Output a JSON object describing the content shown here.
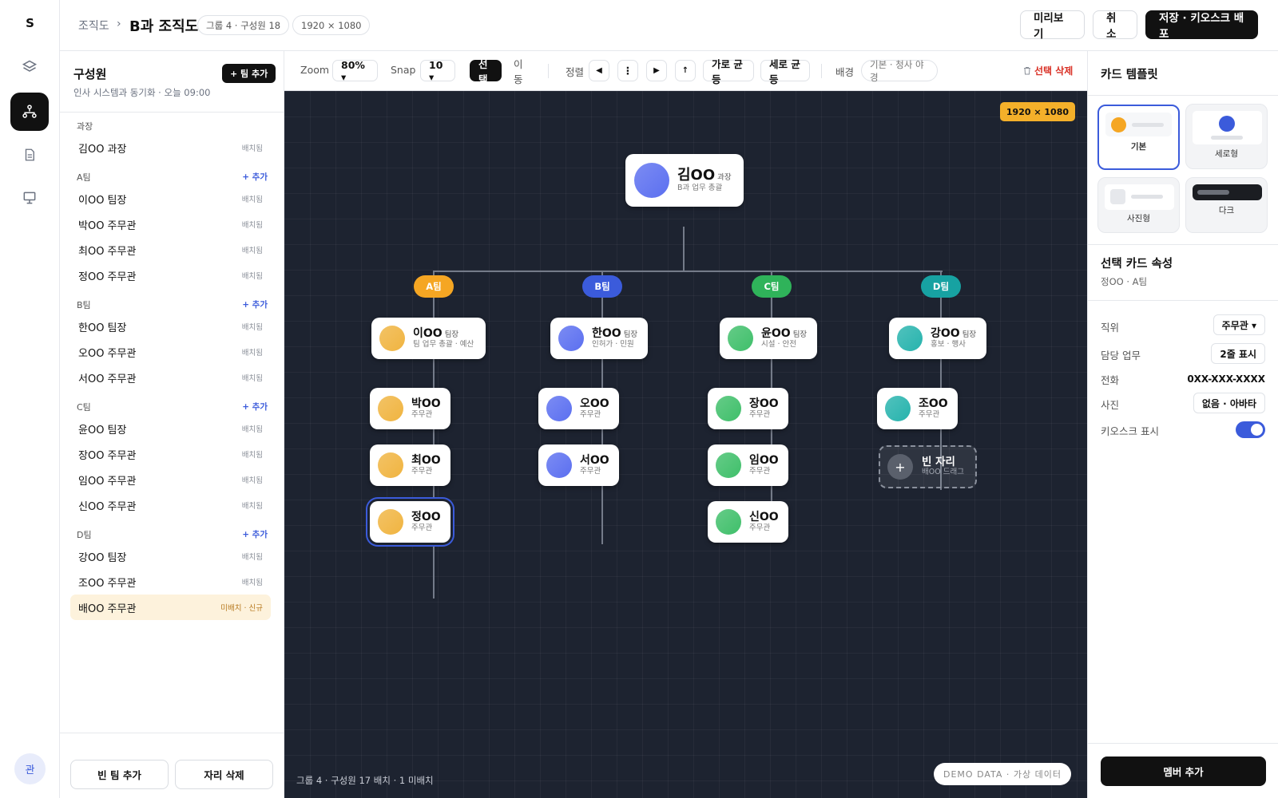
{
  "rail": {
    "logo": "S",
    "avatar": "관"
  },
  "header": {
    "crumb": "조직도",
    "separator": "›",
    "title": "B과 조직도",
    "chip_group": "그룹 4 · 구성원 18",
    "chip_size": "1920 × 1080",
    "preview": "미리보기",
    "cancel": "취소",
    "save": "저장 · 키오스크 배포"
  },
  "left": {
    "title": "구성원",
    "add_team": "+ 팀 추가",
    "sub": "인사 시스템과 동기화 · 오늘 09:00",
    "groups": [
      {
        "name": "과장",
        "add": "",
        "members": [
          {
            "name": "김OO 과장",
            "status": "배치됨"
          }
        ]
      },
      {
        "name": "A팀",
        "add": "+ 추가",
        "members": [
          {
            "name": "이OO 팀장",
            "status": "배치됨"
          },
          {
            "name": "박OO 주무관",
            "status": "배치됨"
          },
          {
            "name": "최OO 주무관",
            "status": "배치됨"
          },
          {
            "name": "정OO 주무관",
            "status": "배치됨"
          }
        ]
      },
      {
        "name": "B팀",
        "add": "+ 추가",
        "members": [
          {
            "name": "한OO 팀장",
            "status": "배치됨"
          },
          {
            "name": "오OO 주무관",
            "status": "배치됨"
          },
          {
            "name": "서OO 주무관",
            "status": "배치됨"
          }
        ]
      },
      {
        "name": "C팀",
        "add": "+ 추가",
        "members": [
          {
            "name": "윤OO 팀장",
            "status": "배치됨"
          },
          {
            "name": "장OO 주무관",
            "status": "배치됨"
          },
          {
            "name": "임OO 주무관",
            "status": "배치됨"
          },
          {
            "name": "신OO 주무관",
            "status": "배치됨"
          }
        ]
      },
      {
        "name": "D팀",
        "add": "+ 추가",
        "members": [
          {
            "name": "강OO 팀장",
            "status": "배치됨"
          },
          {
            "name": "조OO 주무관",
            "status": "배치됨"
          },
          {
            "name": "배OO 주무관",
            "status": "미배치 · 신규"
          }
        ]
      }
    ],
    "empty_team": "빈 팀 추가",
    "delete_slot": "자리 삭제"
  },
  "toolbar": {
    "zoom_label": "Zoom",
    "zoom": "80% ▾",
    "snap_label": "Snap",
    "snap": "10 ▾",
    "select": "선택",
    "move": "이동",
    "align_label": "정렬",
    "align_left": "◀",
    "align_vcenter": "⋮",
    "align_right": "▶",
    "align_top": "↑",
    "dist_h": "가로 균등",
    "dist_v": "세로 균등",
    "bg_label": "배경",
    "bg": "기본 · 청사 야경",
    "delete_sel": "선택 삭제"
  },
  "canvas": {
    "size_badge": "1920 × 1080",
    "root": {
      "name": "김OO",
      "role": "과장",
      "duty": "B과 업무 총괄"
    },
    "teams": [
      {
        "label": "A팀",
        "color": "#f5a623",
        "av": "#f0b440",
        "cards": [
          {
            "name": "이OO",
            "role": "팀장",
            "sub": "팀 업무 총괄 · 예산"
          },
          {
            "name": "박OO",
            "role": "",
            "sub": "주무관"
          },
          {
            "name": "최OO",
            "role": "",
            "sub": "주무관"
          },
          {
            "name": "정OO",
            "role": "",
            "sub": "주무관"
          }
        ]
      },
      {
        "label": "B팀",
        "color": "#3b5bdb",
        "av": "#5b6ff0",
        "cards": [
          {
            "name": "한OO",
            "role": "팀장",
            "sub": "인허가 · 민원"
          },
          {
            "name": "오OO",
            "role": "",
            "sub": "주무관"
          },
          {
            "name": "서OO",
            "role": "",
            "sub": "주무관"
          }
        ]
      },
      {
        "label": "C팀",
        "color": "#2fb35a",
        "av": "#3fbf6a",
        "cards": [
          {
            "name": "윤OO",
            "role": "팀장",
            "sub": "시설 · 안전"
          },
          {
            "name": "장OO",
            "role": "",
            "sub": "주무관"
          },
          {
            "name": "임OO",
            "role": "",
            "sub": "주무관"
          },
          {
            "name": "신OO",
            "role": "",
            "sub": "주무관"
          }
        ]
      },
      {
        "label": "D팀",
        "color": "#17a2a2",
        "av": "#26b3ad",
        "cards": [
          {
            "name": "강OO",
            "role": "팀장",
            "sub": "홍보 · 행사"
          },
          {
            "name": "조OO",
            "role": "",
            "sub": "주무관"
          }
        ]
      }
    ],
    "empty_slot": {
      "title": "빈 자리",
      "sub": "배OO 드래그",
      "icon": "+"
    },
    "status": "그룹 4 · 구성원 17 배치 · 1 미배치",
    "demo": "DEMO DATA · 가상 데이터"
  },
  "right": {
    "templates_title": "카드 템플릿",
    "templates": [
      "기본",
      "세로형",
      "사진형",
      "다크"
    ],
    "selected_title": "선택 카드 속성",
    "selected_sub": "정OO · A팀",
    "props": [
      {
        "label": "직위",
        "value": "주무관 ▾"
      },
      {
        "label": "담당 업무",
        "value": "2줄 표시"
      },
      {
        "label": "전화",
        "value": "0XX-XXX-XXXX"
      },
      {
        "label": "사진",
        "value": "없음 · 아바타"
      },
      {
        "label": "키오스크 표시",
        "value": ""
      }
    ],
    "add_member": "멤버 추가"
  },
  "colors": {
    "accent": "#3b5bdb",
    "canvas_bg": "#1d2330",
    "badge": "#f4b02a",
    "danger": "#d93025"
  }
}
